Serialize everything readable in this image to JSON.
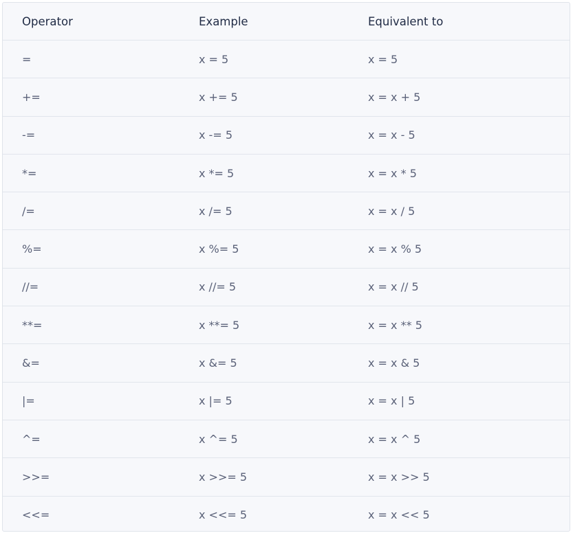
{
  "table": {
    "headers": [
      "Operator",
      "Example",
      "Equivalent to"
    ],
    "rows": [
      [
        "=",
        "x = 5",
        "x = 5"
      ],
      [
        "+=",
        "x += 5",
        "x = x + 5"
      ],
      [
        "-=",
        "x -= 5",
        "x = x - 5"
      ],
      [
        "*=",
        "x *= 5",
        "x = x * 5"
      ],
      [
        "/=",
        "x /= 5",
        "x = x / 5"
      ],
      [
        "%=",
        "x %= 5",
        "x = x % 5"
      ],
      [
        "//=",
        "x //= 5",
        "x = x // 5"
      ],
      [
        "**=",
        "x **= 5",
        "x = x ** 5"
      ],
      [
        "&=",
        "x &= 5",
        "x = x & 5"
      ],
      [
        "|=",
        "x |= 5",
        "x = x | 5"
      ],
      [
        "^=",
        "x ^= 5",
        "x = x ^ 5"
      ],
      [
        ">>=",
        "x >>= 5",
        "x = x >> 5"
      ],
      [
        "<<=",
        "x <<= 5",
        "x = x << 5"
      ]
    ]
  }
}
